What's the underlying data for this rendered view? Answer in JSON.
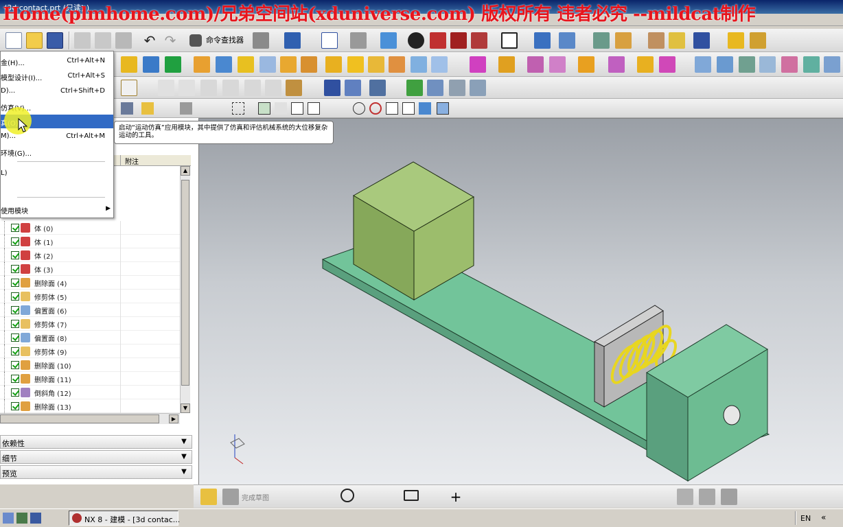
{
  "window": {
    "title": "(3d contact.prt  (只读) )",
    "watermark": "Home(plmhome.com)/兄弟空间站(xduniverse.com) 版权所有 违者必究 --mildcat制作"
  },
  "toolbar": {
    "command_finder": "命令查找器"
  },
  "dropdown": {
    "items": [
      {
        "label": "金(H)...",
        "shortcut": "Ctrl+Alt+N"
      },
      {
        "label": "模型设计(I)...",
        "shortcut": "Ctrl+Alt+S"
      },
      {
        "label": "D)...",
        "shortcut": "Ctrl+Shift+D"
      },
      {
        "label": "仿真(V)...",
        "shortcut": ""
      },
      {
        "label": "真(O)...",
        "shortcut": ""
      },
      {
        "label": "M)...",
        "shortcut": "Ctrl+Alt+M"
      },
      {
        "label": "环境(G)...",
        "shortcut": ""
      },
      {
        "label": "L)",
        "shortcut": ""
      },
      {
        "label": "使用模块",
        "shortcut": ""
      }
    ],
    "tooltip": "启动“运动仿真”应用模块，其中提供了仿真和评估机械系统的大位移复杂运动的工具。"
  },
  "navigator": {
    "col_note": "附注",
    "rows": [
      {
        "label": "体 (0)",
        "icon": "body-icon"
      },
      {
        "label": "体 (1)",
        "icon": "body-icon"
      },
      {
        "label": "体 (2)",
        "icon": "body-icon"
      },
      {
        "label": "体 (3)",
        "icon": "body-icon"
      },
      {
        "label": "删除面 (4)",
        "icon": "delete-face-icon"
      },
      {
        "label": "修剪体 (5)",
        "icon": "trim-body-icon"
      },
      {
        "label": "偏置面 (6)",
        "icon": "offset-face-icon"
      },
      {
        "label": "修剪体 (7)",
        "icon": "trim-body-icon"
      },
      {
        "label": "偏置面 (8)",
        "icon": "offset-face-icon"
      },
      {
        "label": "修剪体 (9)",
        "icon": "trim-body-icon"
      },
      {
        "label": "删除面 (10)",
        "icon": "delete-face-icon"
      },
      {
        "label": "删除面 (11)",
        "icon": "delete-face-icon"
      },
      {
        "label": "倒斜角 (12)",
        "icon": "chamfer-icon"
      },
      {
        "label": "删除面 (13)",
        "icon": "delete-face-icon"
      }
    ],
    "sections": [
      "依赖性",
      "细节",
      "预览"
    ]
  },
  "bottom_toolbar": {
    "finish_sketch": "完成草图"
  },
  "taskbar": {
    "task": "NX 8 - 建模 - [3d contac...",
    "lang": "EN",
    "chevrons": "«"
  },
  "colors": {
    "body_green": "#96b86c",
    "base_green": "#72c49a",
    "spring_yellow": "#e8d620",
    "menu_highlight": "#316ac5",
    "watermark_red": "#e8141c"
  }
}
